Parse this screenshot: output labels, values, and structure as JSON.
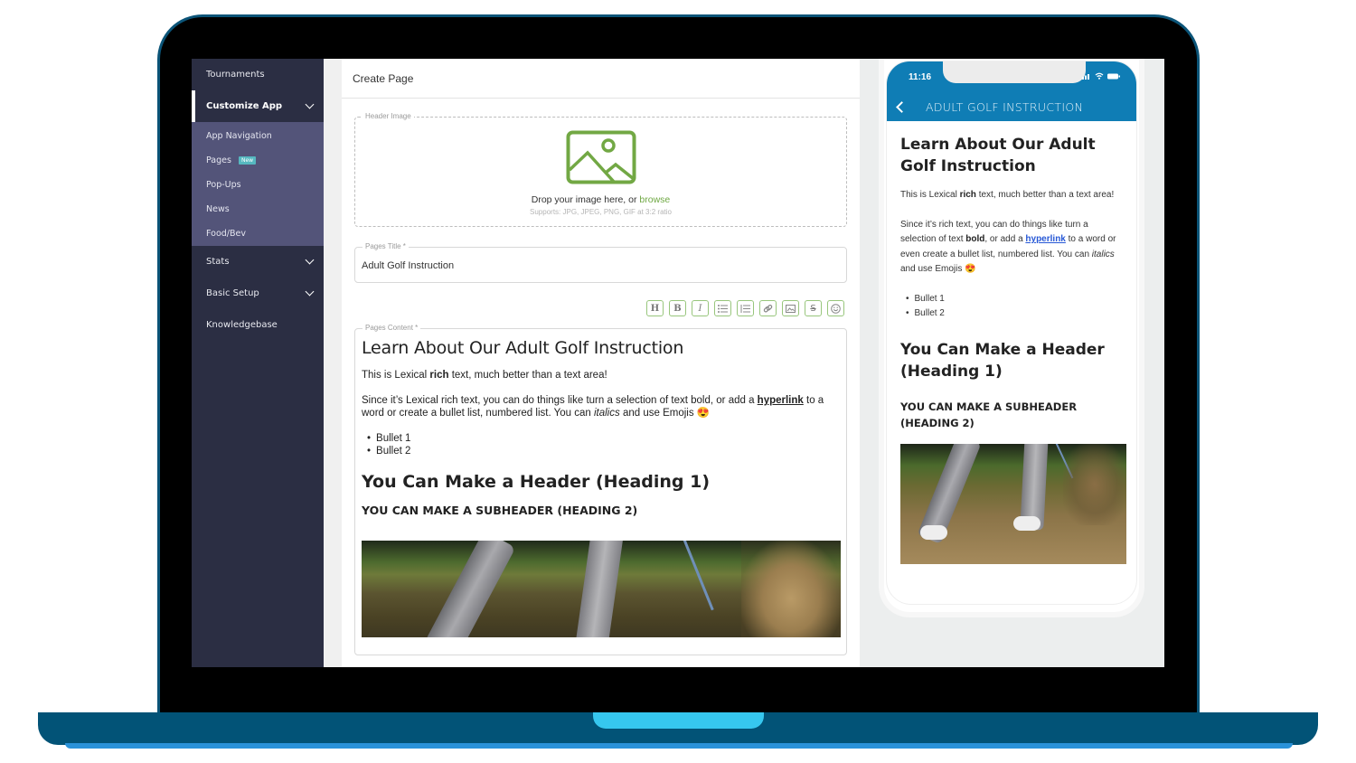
{
  "sidebar": {
    "items": [
      {
        "label": "Tournaments",
        "expandable": false,
        "active": false
      },
      {
        "label": "Customize App",
        "expandable": true,
        "active": true
      },
      {
        "label": "Stats",
        "expandable": true,
        "active": false
      },
      {
        "label": "Basic Setup",
        "expandable": true,
        "active": false
      },
      {
        "label": "Knowledgebase",
        "expandable": false,
        "active": false
      }
    ],
    "submenu": [
      {
        "label": "App Navigation"
      },
      {
        "label": "Pages",
        "badge": "New"
      },
      {
        "label": "Pop-Ups"
      },
      {
        "label": "News"
      },
      {
        "label": "Food/Bev"
      }
    ]
  },
  "editor": {
    "page_title": "Create Page",
    "header_image": {
      "legend": "Header Image",
      "drop_text": "Drop your image here, or ",
      "browse_label": "browse",
      "supports": "Supports: JPG, JPEG, PNG, GIF at 3:2 ratio"
    },
    "title_field": {
      "legend": "Pages Title *",
      "value": "Adult Golf Instruction"
    },
    "toolbar": [
      {
        "name": "heading",
        "icon": "heading-icon",
        "glyph": "H"
      },
      {
        "name": "bold",
        "icon": "bold-icon",
        "glyph": "B"
      },
      {
        "name": "italic",
        "icon": "italic-icon",
        "glyph": "I"
      },
      {
        "name": "bullet-list",
        "icon": "bullet-list-icon"
      },
      {
        "name": "numbered-list",
        "icon": "numbered-list-icon"
      },
      {
        "name": "link",
        "icon": "link-icon"
      },
      {
        "name": "image",
        "icon": "image-icon"
      },
      {
        "name": "strikethrough",
        "icon": "strikethrough-icon",
        "glyph": "S"
      },
      {
        "name": "emoji",
        "icon": "emoji-icon"
      }
    ],
    "content_field": {
      "legend": "Pages Content *",
      "h1": "Learn About Our Adult Golf Instruction",
      "p1_before": "This is Lexical ",
      "p1_bold": "rich",
      "p1_after": " text, much better than a text area!",
      "p2_before": "Since it’s Lexical rich text, you can do things like turn a selection of text bold, or add a ",
      "p2_link": "hyperlink",
      "p2_mid": " to a word or create a bullet list, numbered list. You can ",
      "p2_italic": "italics",
      "p2_after": " and use Emojis ",
      "emoji": "😍",
      "bullets": [
        "Bullet 1",
        "Bullet 2"
      ],
      "h1b": "You Can Make a Header (Heading 1)",
      "h2": "YOU CAN MAKE A SUBHEADER (HEADING 2)"
    }
  },
  "preview": {
    "status_time": "11:16",
    "nav_title": "ADULT GOLF INSTRUCTION",
    "h1": "Learn About Our Adult Golf Instruction",
    "p1_before": "This is Lexical ",
    "p1_bold": "rich",
    "p1_after": " text, much better than a text area!",
    "p2_before": "Since it’s rich text, you can do things like turn a selection of text ",
    "p2_bold": "bold",
    "p2_mid1": ", or add a ",
    "p2_link": "hyperlink",
    "p2_mid2": " to a word or even create a bullet list, numbered list. You can ",
    "p2_italic": "italics",
    "p2_after": " and use Emojis ",
    "emoji": "😍",
    "bullets": [
      "Bullet 1",
      "Bullet 2"
    ],
    "h1b": "You Can Make a Header (Heading 1)",
    "h2": "YOU CAN MAKE A SUBHEADER (HEADING 2)"
  },
  "colors": {
    "sidebar_bg": "#2b2e43",
    "submenu_bg": "#535479",
    "accent_green": "#6fa843",
    "phone_header": "#0f7db5",
    "link_blue": "#2758d6",
    "laptop_frame": "#025377"
  }
}
